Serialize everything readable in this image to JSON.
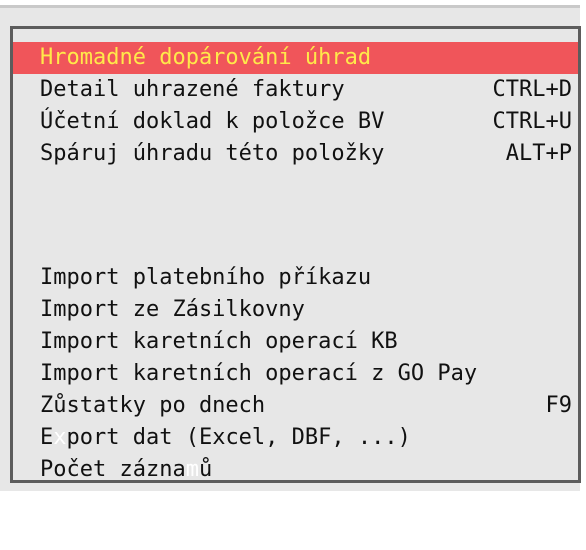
{
  "menu": {
    "items": [
      {
        "label": "Hromadné dopárování úhrad",
        "shortcut": ""
      },
      {
        "label": "Detail uhrazené faktury",
        "shortcut": "CTRL+D"
      },
      {
        "label": "Účetní doklad k položce BV",
        "shortcut": "CTRL+U"
      },
      {
        "label": "Spáruj úhradu této položky",
        "shortcut": "ALT+P"
      },
      {
        "label": "Import platebního příkazu",
        "shortcut": ""
      },
      {
        "label": "Import ze Zásilkovny",
        "shortcut": ""
      },
      {
        "label": "Import karetních operací KB",
        "shortcut": ""
      },
      {
        "label": "Import karetních operací z GO Pay",
        "shortcut": ""
      },
      {
        "label": "Zůstatky po dnech",
        "shortcut": "F9"
      },
      {
        "export": {
          "before": "E",
          "hotkey": "x",
          "after": "port dat (Excel, DBF, ...)"
        }
      },
      {
        "count": {
          "before": "Počet zázna",
          "hotkey": "m",
          "after": "ů"
        }
      }
    ],
    "selected_index": 0
  },
  "colors": {
    "selected_bg": "#f0555a",
    "selected_fg": "#ffe94a",
    "menu_bg": "#e7e7e7",
    "text": "#111111",
    "hotkey": "#ffffff"
  }
}
